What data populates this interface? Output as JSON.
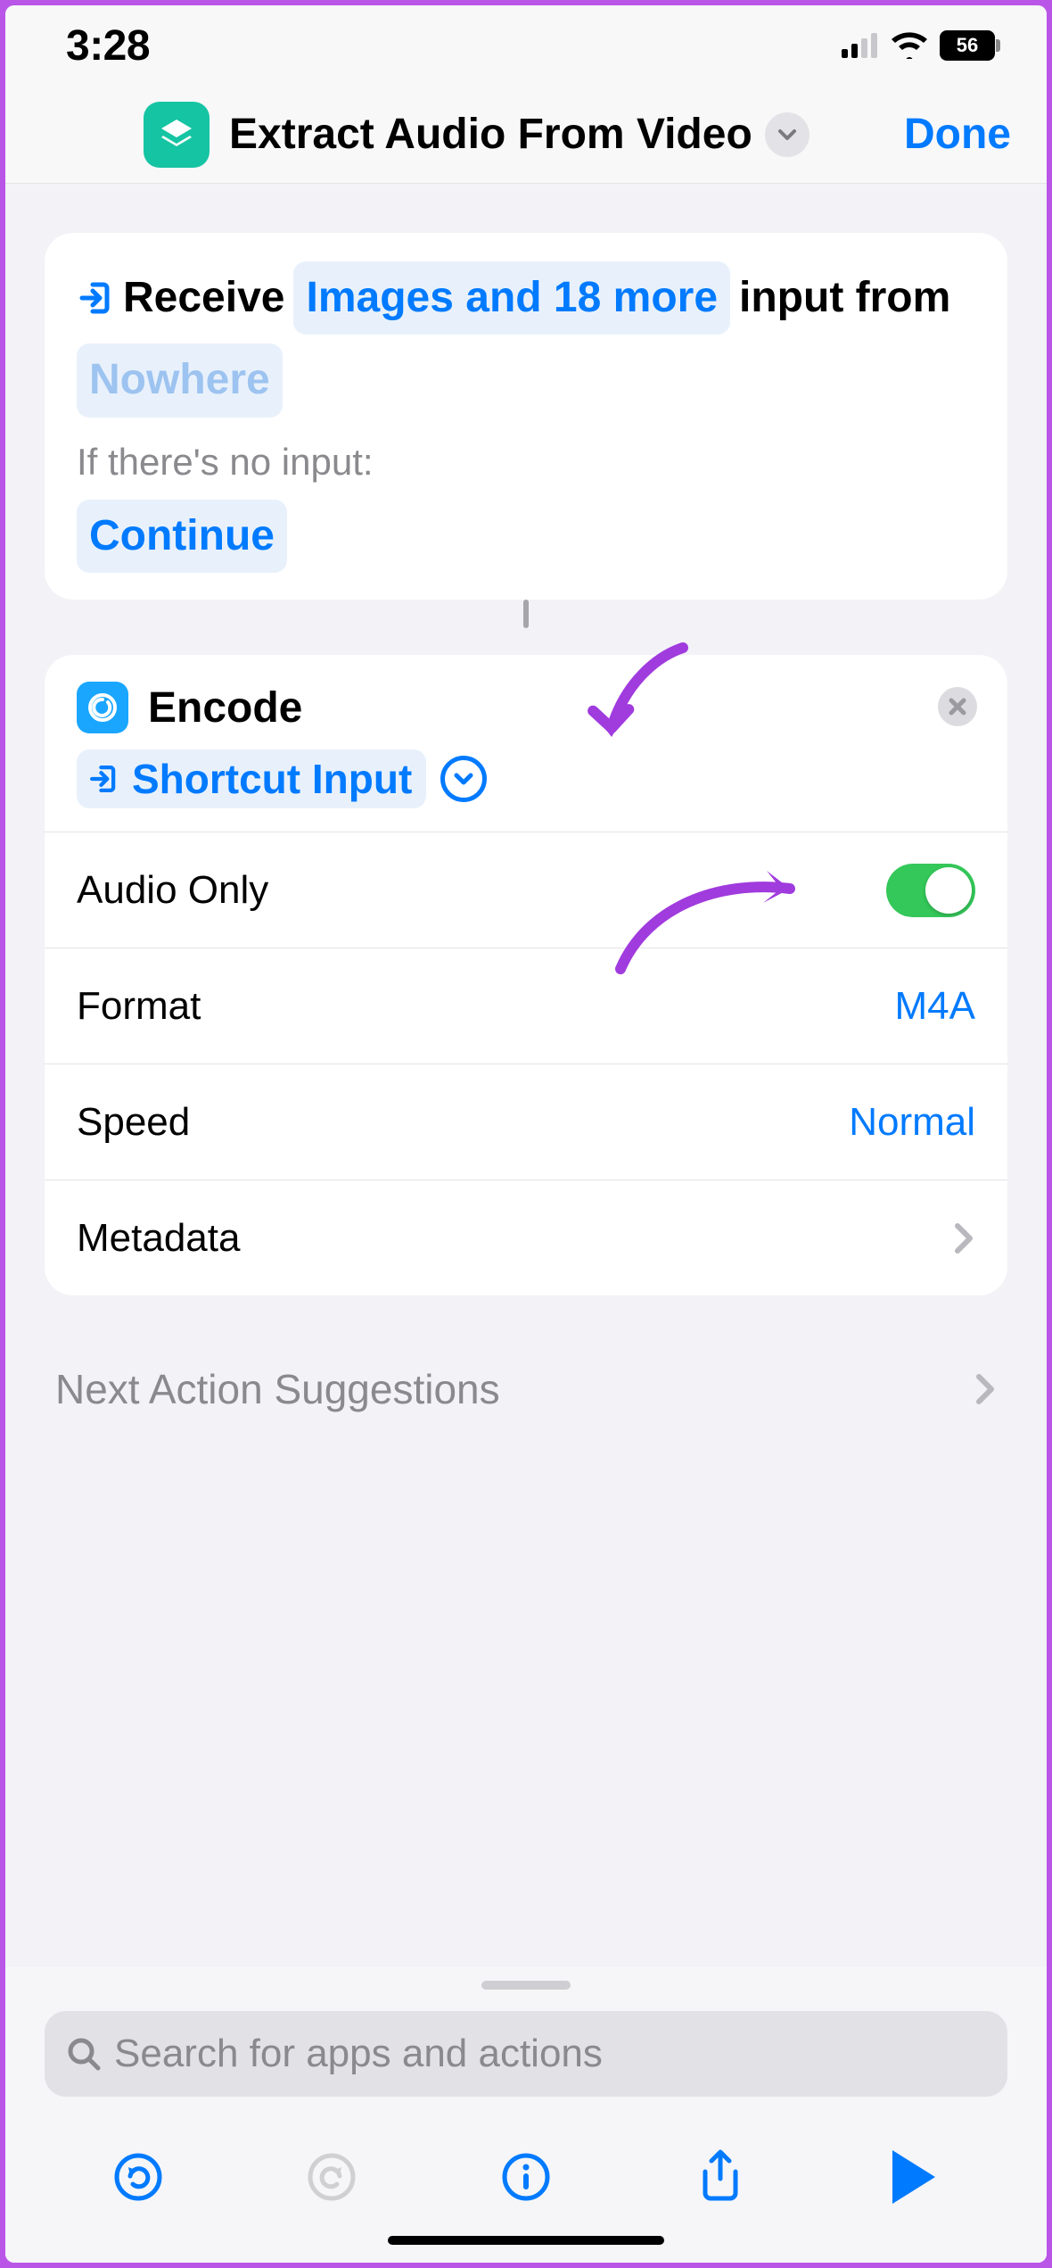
{
  "status": {
    "time": "3:28",
    "battery_pct": "56"
  },
  "header": {
    "title": "Extract Audio From Video",
    "done": "Done"
  },
  "receive": {
    "verb": "Receive",
    "types_pill": "Images and 18 more",
    "middle": "input from",
    "source_pill": "Nowhere",
    "noinput_label": "If there's no input:",
    "noinput_action": "Continue"
  },
  "encode": {
    "title": "Encode",
    "input_pill": "Shortcut Input",
    "rows": {
      "audio_only": "Audio Only",
      "format_label": "Format",
      "format_value": "M4A",
      "speed_label": "Speed",
      "speed_value": "Normal",
      "metadata": "Metadata"
    }
  },
  "suggestions": "Next Action Suggestions",
  "search": {
    "placeholder": "Search for apps and actions"
  }
}
